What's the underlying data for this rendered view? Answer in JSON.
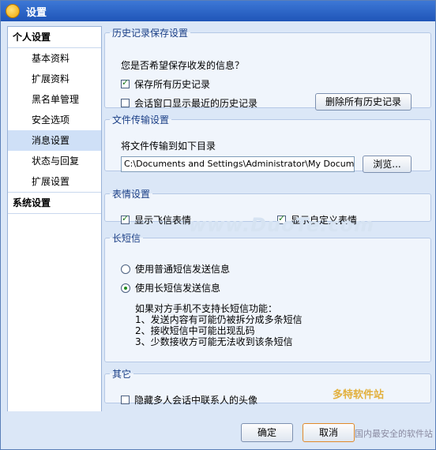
{
  "window": {
    "title": "设置"
  },
  "sidebar": {
    "group_personal": "个人设置",
    "items": [
      {
        "label": "基本资料"
      },
      {
        "label": "扩展资料"
      },
      {
        "label": "黑名单管理"
      },
      {
        "label": "安全选项"
      },
      {
        "label": "消息设置"
      },
      {
        "label": "状态与回复"
      },
      {
        "label": "扩展设置"
      }
    ],
    "selected_index": 4,
    "group_system": "系统设置"
  },
  "history": {
    "legend": "历史记录保存设置",
    "question": "您是否希望保存收发的信息？",
    "save_all_label": "保存所有历史记录",
    "save_all_checked": true,
    "show_recent_label": "会话窗口显示最近的历史记录",
    "show_recent_checked": false,
    "delete_button": "删除所有历史记录"
  },
  "file_transfer": {
    "legend": "文件传输设置",
    "description": "将文件传输到如下目录",
    "path_value": "C:\\Documents and Settings\\Administrator\\My Documents\\My Fe",
    "browse_button": "浏览..."
  },
  "emoticons": {
    "legend": "表情设置",
    "show_fetion_label": "显示飞信表情",
    "show_fetion_checked": true,
    "show_custom_label": "显示自定义表情",
    "show_custom_checked": true
  },
  "long_sms": {
    "legend": "长短信",
    "normal_label": "使用普通短信发送信息",
    "long_label": "使用长短信发送信息",
    "selected": "long",
    "note_intro": "如果对方手机不支持长短信功能：",
    "note_items": [
      "1、发送内容有可能仍被拆分成多条短信",
      "2、接收短信中可能出现乱码",
      "3、少数接收方可能无法收到该条短信"
    ]
  },
  "other": {
    "legend": "其它",
    "hide_avatar_label": "隐藏多人会话中联系人的头像",
    "hide_avatar_checked": false
  },
  "footer": {
    "ok_button": "确定",
    "cancel_button": "取消"
  },
  "overlays": {
    "watermark": "www.DuoTe.com",
    "badge": "多特软件站",
    "site_text": "国内最安全的软件站"
  },
  "colors": {
    "title_bar": "#2a62c4",
    "window_bg": "#dbe7f7",
    "legend_text": "#1b3f86",
    "check_green": "#1d7a1d"
  }
}
